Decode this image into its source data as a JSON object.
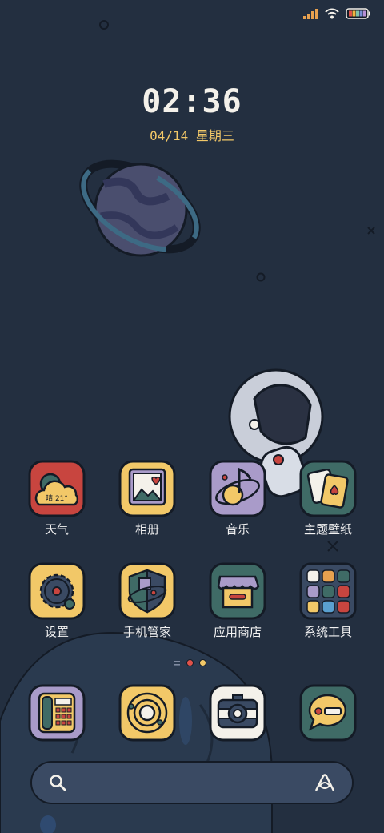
{
  "status_bar": {
    "icons": [
      "signal-icon",
      "wifi-icon",
      "battery-icon"
    ],
    "colors": {
      "signal": "#e8a14f",
      "wifi": "#f4f1ea",
      "battery_stripes": [
        "#e0524a",
        "#f0b640",
        "#7fc3a9",
        "#7a8fd6",
        "#b58fd6"
      ]
    }
  },
  "clock": {
    "time": "02:36",
    "date": "04/14 星期三"
  },
  "weather_widget": {
    "text": "晴 21°"
  },
  "apps_row1": [
    {
      "label": "天气",
      "icon": "weather-icon"
    },
    {
      "label": "相册",
      "icon": "gallery-icon"
    },
    {
      "label": "音乐",
      "icon": "music-icon"
    },
    {
      "label": "主题壁纸",
      "icon": "themes-icon"
    }
  ],
  "apps_row2": [
    {
      "label": "设置",
      "icon": "settings-icon"
    },
    {
      "label": "手机管家",
      "icon": "security-icon"
    },
    {
      "label": "应用商店",
      "icon": "app-store-icon"
    },
    {
      "label": "系统工具",
      "icon": "tools-folder-icon"
    }
  ],
  "dock": [
    {
      "icon": "phone-icon"
    },
    {
      "icon": "browser-icon"
    },
    {
      "icon": "camera-icon"
    },
    {
      "icon": "messages-icon"
    }
  ],
  "page_indicator": {
    "pages": 2,
    "current": 1,
    "colors": [
      "#e0524a",
      "#f2c868"
    ]
  },
  "search_bar": {
    "icons": [
      "search-icon",
      "assistant-icon"
    ]
  },
  "theme_colors": {
    "background": "#232f40",
    "outline": "#141b26",
    "yellow": "#f2c868",
    "red": "#c8453f",
    "purple": "#a99bc9",
    "teal": "#3f6b66",
    "cream": "#f4f1ea"
  }
}
